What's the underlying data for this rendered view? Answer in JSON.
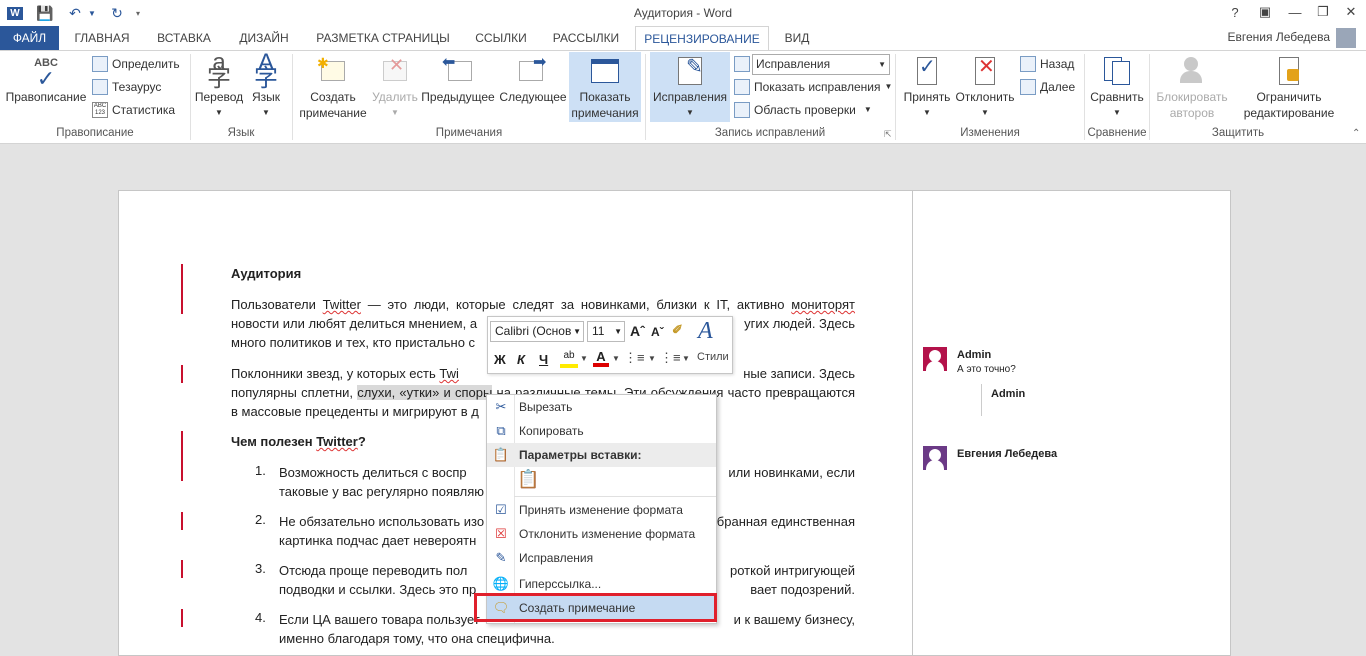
{
  "window": {
    "title": "Аудитория - Word",
    "help": "?"
  },
  "user": {
    "name": "Евгения Лебедева"
  },
  "tabs": [
    {
      "label": "ФАЙЛ"
    },
    {
      "label": "ГЛАВНАЯ"
    },
    {
      "label": "ВСТАВКА"
    },
    {
      "label": "ДИЗАЙН"
    },
    {
      "label": "РАЗМЕТКА СТРАНИЦЫ"
    },
    {
      "label": "ССЫЛКИ"
    },
    {
      "label": "РАССЫЛКИ"
    },
    {
      "label": "РЕЦЕНЗИРОВАНИЕ"
    },
    {
      "label": "ВИД"
    }
  ],
  "ribbon": {
    "proofing": {
      "group": "Правописание",
      "spelling": "Правописание",
      "spelling_icon_text": "ABC",
      "define": "Определить",
      "thesaurus": "Тезаурус",
      "stats": "Статистика",
      "stats_icon_text": "ABC 123"
    },
    "language": {
      "group": "Язык",
      "translate": "Перевод",
      "language": "Язык"
    },
    "comments": {
      "group": "Примечания",
      "new_line1": "Создать",
      "new_line2": "примечание",
      "delete": "Удалить",
      "previous": "Предыдущее",
      "next": "Следующее",
      "show_line1": "Показать",
      "show_line2": "примечания"
    },
    "tracking": {
      "group": "Запись исправлений",
      "track": "Исправления",
      "display_select": "Исправления",
      "show_markup": "Показать исправления",
      "review_pane": "Область проверки"
    },
    "changes": {
      "group": "Изменения",
      "accept": "Принять",
      "reject": "Отклонить",
      "back": "Назад",
      "forward": "Далее"
    },
    "compare": {
      "group": "Сравнение",
      "compare": "Сравнить"
    },
    "protect": {
      "group": "Защитить",
      "block_line1": "Блокировать",
      "block_line2": "авторов",
      "restrict_line1": "Ограничить",
      "restrict_line2": "редактирование"
    }
  },
  "document": {
    "heading": "Аудитория",
    "p1": {
      "l1a": "Пользователи ",
      "l1b": "Twitter",
      "l1c": " — это люди, которые следят за новинками, близки к IT, активно ",
      "l1d": "мониторят",
      "l2a": "новости или любят делиться мнением, а",
      "l2b": "угих людей. Здесь",
      "l3": "много политиков и тех, кто пристально с"
    },
    "p2": {
      "l1a": "Поклонники звезд, у которых есть ",
      "l1b": "Twi",
      "l1c": "ные записи. Здесь",
      "l2a": "популярны сплетни, ",
      "l2b": "слухи, «утки» и споры",
      "l2c": " на различные темы. Эти обсуждения часто превращаются",
      "l3": "в массовые прецеденты и мигрируют в д"
    },
    "subheading_a": "Чем полезен ",
    "subheading_b": "Twitter",
    "subheading_c": "?",
    "list": [
      {
        "num": "1.",
        "l1a": "Возможность делиться с воспр",
        "l1b": "или новинками, если",
        "l2": "таковые у вас регулярно появляю"
      },
      {
        "num": "2.",
        "l1a": "Не обязательно использовать изо",
        "l1b": "бранная единственная",
        "l2": "картинка подчас дает невероятн"
      },
      {
        "num": "3.",
        "l1a": "Отсюда проще переводить пол",
        "l1b": "роткой интригующей",
        "l2a": "подводки и ссылки. Здесь это пр",
        "l2b": "вает подозрений."
      },
      {
        "num": "4.",
        "l1a": "Если ЦА вашего товара пользует",
        "l1b": "и к вашему бизнесу,",
        "l2": "именно благодаря тому, что она специфична."
      }
    ]
  },
  "comments": [
    {
      "author": "Admin",
      "text": "А это точно?"
    },
    {
      "author": "Admin",
      "text": ""
    },
    {
      "author": "Евгения Лебедева",
      "text": ""
    }
  ],
  "mini_toolbar": {
    "font": "Calibri (Основ",
    "size": "11",
    "bold": "Ж",
    "italic": "К",
    "underline": "Ч",
    "styles": "Стили"
  },
  "context_menu": {
    "cut": "Вырезать",
    "copy": "Копировать",
    "paste_options": "Параметры вставки:",
    "accept_format": "Принять изменение формата",
    "reject_format": "Отклонить изменение формата",
    "track_changes": "Исправления",
    "hyperlink": "Гиперссылка...",
    "new_comment": "Создать примечание"
  },
  "colors": {
    "accent": "#2b579a",
    "change_bar": "#c8102e",
    "highlight_frame": "#e0202c"
  }
}
